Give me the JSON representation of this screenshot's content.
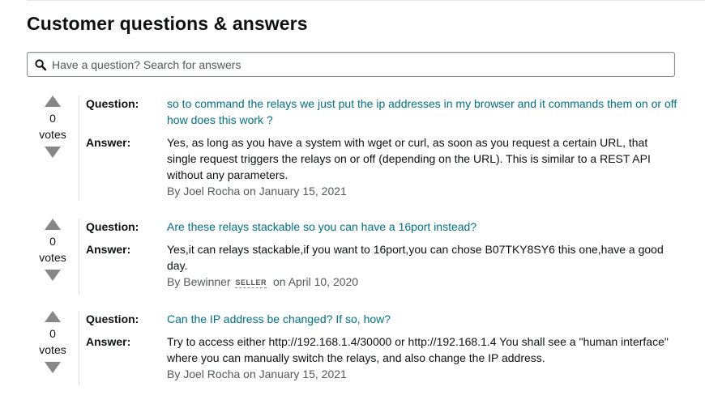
{
  "page": {
    "title": "Customer questions & answers",
    "search_placeholder": "Have a question? Search for answers"
  },
  "colors": {
    "question_link": "#007185",
    "vote_arrow": "#878787",
    "byline": "#565959"
  },
  "labels": {
    "question": "Question:",
    "answer": "Answer:",
    "votes": "votes",
    "seller": "SELLER"
  },
  "qas": [
    {
      "votes": "0",
      "question": "so to command the relays we just put the ip addresses in my browser and it commands them on or off how does this work ?",
      "answer": "Yes, as long as you have a system with wget or curl, as soon as you request a certain URL, that single request triggers the relays on or off (depending on the URL). This is similar to a REST API without any parameters.",
      "byline": "By Joel Rocha on January 15, 2021"
    },
    {
      "votes": "0",
      "question": "Are these relays stackable so you can have a 16port instead?",
      "answer": "Yes,it can relays stackable,if you want to 16port,you can chose B07TKY8SY6 this one,have a good day.",
      "byline_author": "By Bewinner",
      "byline_date": "on April 10, 2020"
    },
    {
      "votes": "0",
      "question": "Can the IP address be changed? If so, how?",
      "answer": "Try to access either http://192.168.1.4/30000 or http://192.168.1.4 You shall see a \"human interface\" where you can manually switch the relays, and also change the IP address.",
      "byline": "By Joel Rocha on January 15, 2021"
    }
  ]
}
